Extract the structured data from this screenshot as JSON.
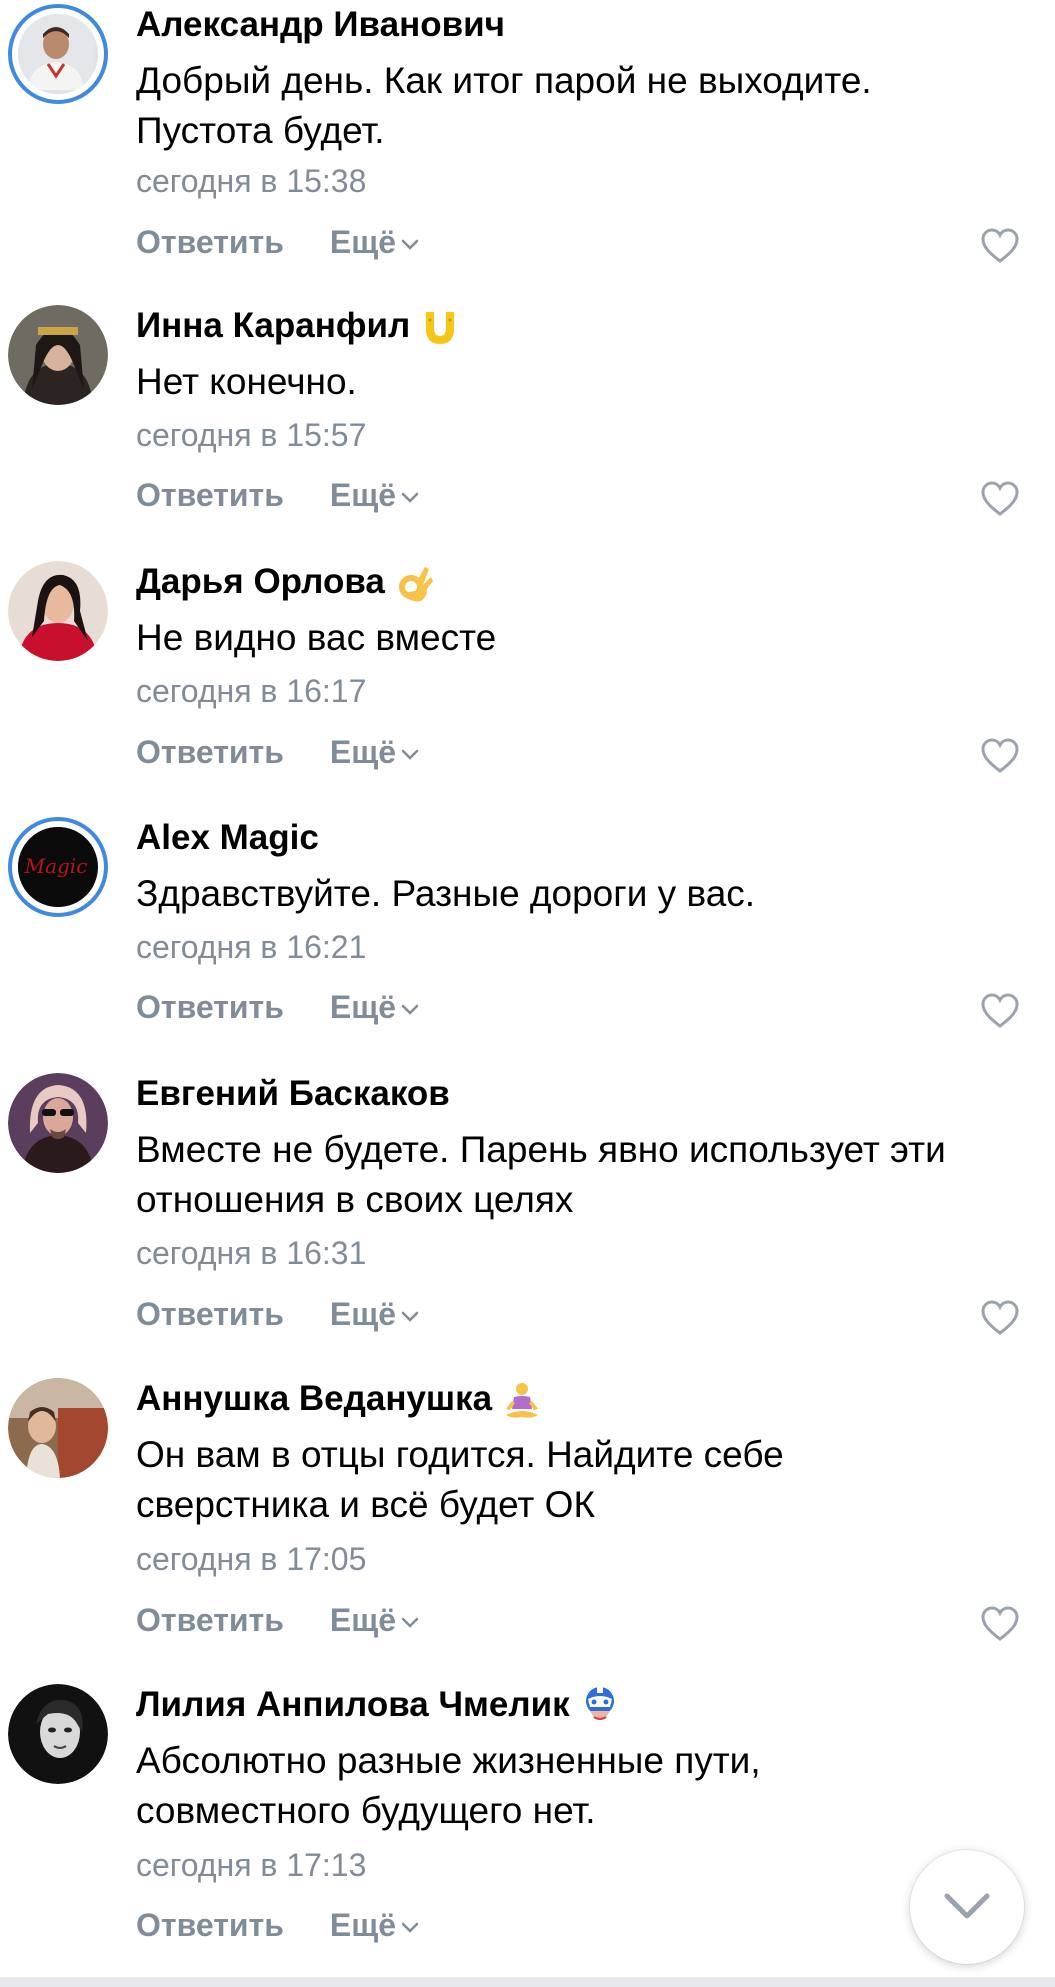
{
  "comments": [
    {
      "author": "Александр Иванович",
      "text": "Добрый день. Как итог парой не выходите.\nПустота будет.",
      "time": "сегодня в 15:38",
      "reply_label": "Ответить",
      "more_label": "Ещё",
      "badge": null,
      "has_story_ring": true
    },
    {
      "author": "Инна Каранфил",
      "text": "Нет конечно.",
      "time": "сегодня в 15:57",
      "reply_label": "Ответить",
      "more_label": "Ещё",
      "badge": "horseshoe-icon",
      "has_story_ring": false
    },
    {
      "author": "Дарья Орлова",
      "text": "Не видно вас вместе",
      "time": "сегодня в 16:17",
      "reply_label": "Ответить",
      "more_label": "Ещё",
      "badge": "ok-hand-emoji-icon",
      "has_story_ring": false
    },
    {
      "author": "Alex Magic",
      "text": "Здравствуйте. Разные дороги у вас.",
      "time": "сегодня в 16:21",
      "reply_label": "Ответить",
      "more_label": "Ещё",
      "badge": null,
      "avatar_text": "Magic",
      "has_story_ring": true
    },
    {
      "author": "Евгений Баскаков",
      "text": "Вместе не будете. Парень явно использует эти\nотношения в своих целях",
      "time": "сегодня в 16:31",
      "reply_label": "Ответить",
      "more_label": "Ещё",
      "badge": null,
      "has_story_ring": false
    },
    {
      "author": "Аннушка Веданушка",
      "text": "Он вам в отцы годится. Найдите себе\nсверстника и всё будет ОК",
      "time": "сегодня в 17:05",
      "reply_label": "Ответить",
      "more_label": "Ещё",
      "badge": "meditation-emoji-icon",
      "has_story_ring": false
    },
    {
      "author": "Лилия Анпилова Чмелик",
      "text": "Абсолютно разные жизненные пути,\nсовместного будущего нет.",
      "time": "сегодня в 17:13",
      "reply_label": "Ответить",
      "more_label": "Ещё",
      "badge": "hero-mask-icon",
      "has_story_ring": false
    }
  ],
  "colors": {
    "secondary_text": "#818c99",
    "story_ring": "#3f8ae0",
    "primary_text": "#000000"
  },
  "scroll_down_button_icon": "chevron-down-icon"
}
